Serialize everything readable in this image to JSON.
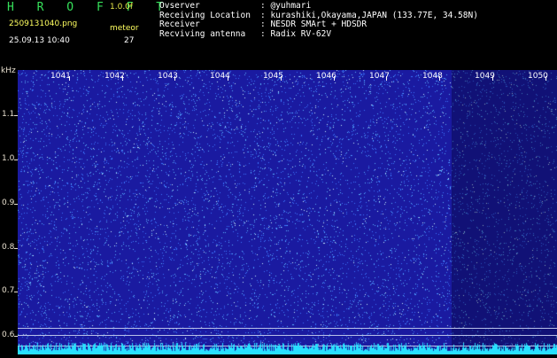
{
  "header": {
    "brand": "H R O F F T",
    "version": "1.0.0f",
    "filename": "2509131040.png",
    "mode": "meteor",
    "datetime": "25.09.13 10:40",
    "count": "27",
    "info": [
      {
        "key": "Ovserver",
        "value": ": @yuhmari"
      },
      {
        "key": "Receiving Location",
        "value": ": kurashiki,Okayama,JAPAN (133.77E, 34.58N)"
      },
      {
        "key": "Receiver",
        "value": ": NESDR SMArt + HDSDR"
      },
      {
        "key": "Recviving antenna",
        "value": ": Radix RV-62V"
      }
    ]
  },
  "spectrogram": {
    "unit": "kHz",
    "freq_labels": [
      "1041",
      "1042",
      "1043",
      "1044",
      "1045",
      "1046",
      "1047",
      "1048",
      "1049",
      "1050"
    ],
    "level_labels": [
      "1.1",
      "1.0",
      "0.9",
      "0.8",
      "0.7",
      "0.6"
    ],
    "colors": {
      "bg": "#1a1aa0",
      "dot_a": "#3c78ff",
      "dot_b": "#5ab4ff",
      "dot_c": "#c8f0ff",
      "noise": "#28e0ff"
    }
  }
}
